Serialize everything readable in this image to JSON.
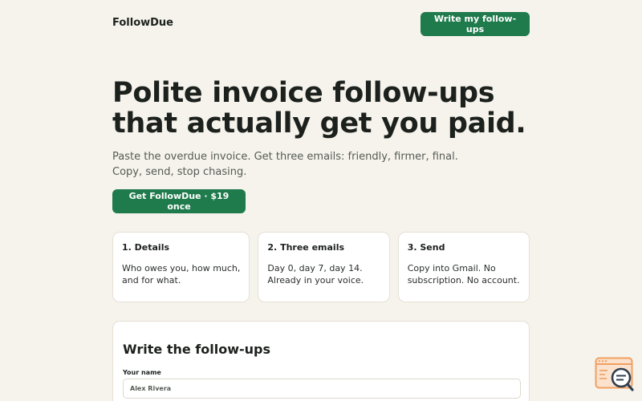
{
  "header": {
    "brand": "FollowDue",
    "cta_label": "Write my follow-ups"
  },
  "hero": {
    "title_lines": [
      "Polite invoice follow-ups",
      "that actually get you paid."
    ],
    "subtitle_lines": [
      "Paste the overdue invoice. Get three emails: friendly, firmer, final.",
      "Copy, send, stop chasing."
    ],
    "cta_label": "Get FollowDue · $19 once"
  },
  "steps": [
    {
      "title": "1. Details",
      "body_lines": [
        "Who owes you, how much,",
        "and for what."
      ]
    },
    {
      "title": "2. Three emails",
      "body_lines": [
        "Day 0, day 7, day 14.",
        "Already in your voice."
      ]
    },
    {
      "title": "3. Send",
      "body_lines": [
        "Copy into Gmail. No",
        "subscription. No account."
      ]
    }
  ],
  "form": {
    "title": "Write the follow-ups",
    "name_label": "Your name",
    "name_value": "Alex Rivera"
  },
  "colors": {
    "background": "#f6f3ec",
    "accent": "#1f7a4c",
    "card": "#ffffff",
    "widget_accent": "#f0a060"
  },
  "icons": {
    "help_widget": "search-window-icon"
  }
}
